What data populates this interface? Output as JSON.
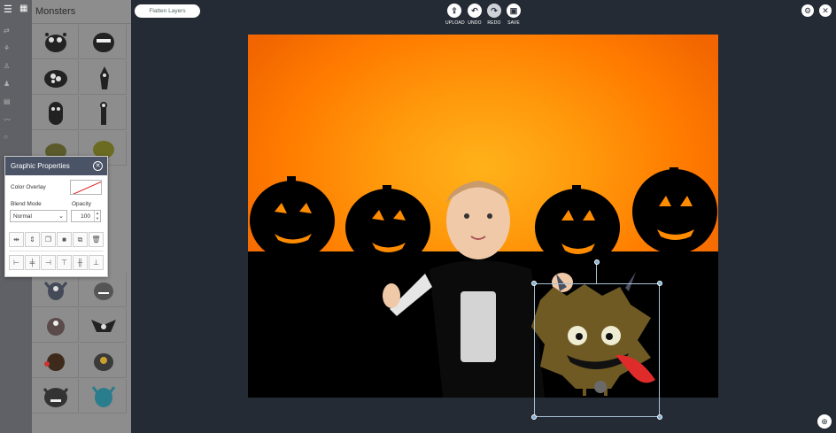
{
  "panel": {
    "title": "Monsters"
  },
  "toolbar": {
    "flatten_label": "Flatten Layers",
    "upload_label": "UPLOAD",
    "undo_label": "UNDO",
    "redo_label": "REDO",
    "save_label": "SAVE"
  },
  "dialog": {
    "title": "Graphic Properties",
    "color_overlay_label": "Color Overlay",
    "blend_mode_label": "Blend Mode",
    "blend_mode_value": "Normal",
    "opacity_label": "Opacity",
    "opacity_value": "100"
  },
  "colors": {
    "background": "#252b35",
    "canvas_orange": "#ff8a00",
    "dialog_header": "#4b5467",
    "panel": "#8d8d8d"
  },
  "icons": [
    "hamburger-icon",
    "grid-icon",
    "settings-icon",
    "close-icon",
    "upload-icon",
    "undo-icon",
    "redo-icon",
    "save-icon",
    "zoom-icon"
  ]
}
